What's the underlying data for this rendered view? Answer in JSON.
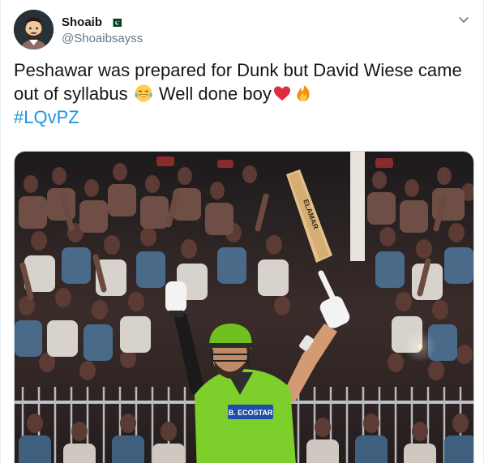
{
  "user": {
    "display_name": "Shoaib",
    "handle": "@Shoaibsayss",
    "flag_icon": "pakistan-flag-icon",
    "avatar_icon": "cartoon-avatar-icon"
  },
  "menu": {
    "caret_icon": "chevron-down-icon"
  },
  "tweet": {
    "text_part1": "Peshawar was prepared for Dunk but David Wiese came out of syllabus ",
    "emoji1": "tears-of-joy-emoji",
    "text_part2": " Well done boy",
    "emoji2": "red-heart-emoji",
    "emoji3": "fire-emoji",
    "hashtag": "#LQvPZ"
  },
  "media": {
    "bat_text": "ELAMAR",
    "jersey_text": "B. ECOSTAR"
  },
  "colors": {
    "text": "#14171a",
    "secondary": "#657786",
    "link": "#1b95e0",
    "jersey_green": "#7dcf2b"
  }
}
